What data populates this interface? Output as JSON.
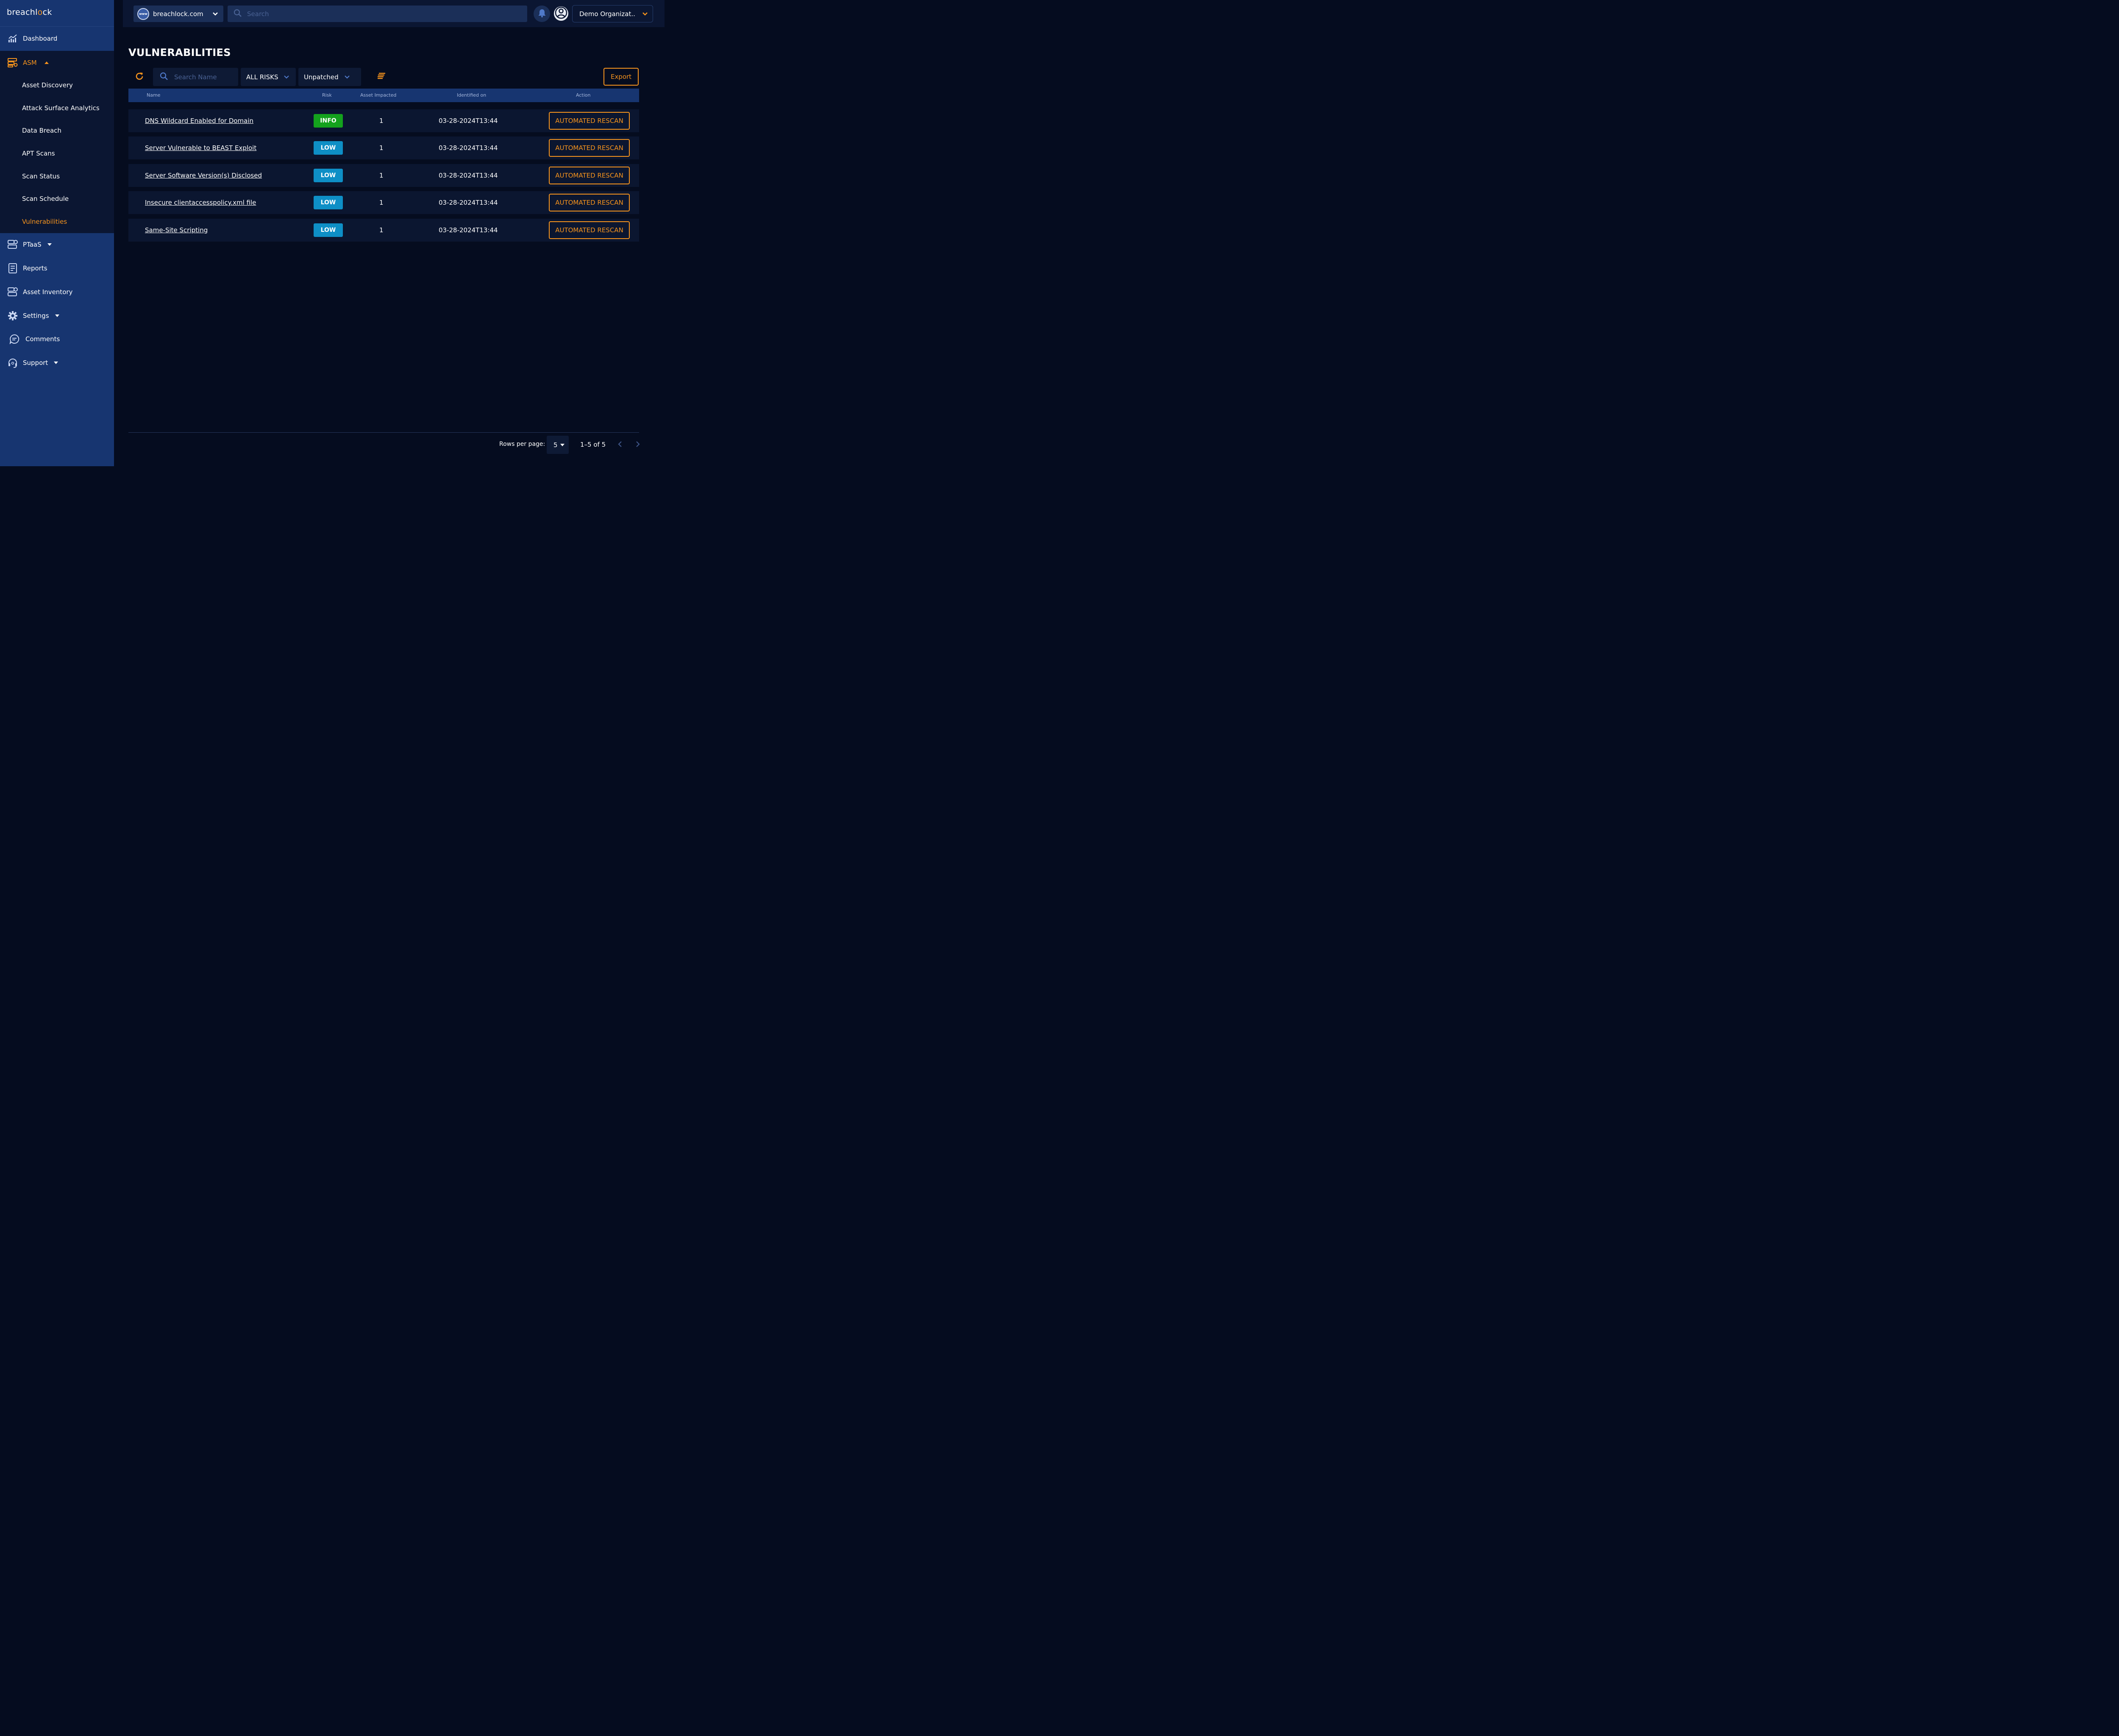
{
  "sidebar": {
    "logo": {
      "text_before": "breachl",
      "mark": "o",
      "text_after": "ck"
    },
    "dashboard": {
      "label": "Dashboard",
      "icon": "chart-line-icon"
    },
    "asm": {
      "label": "ASM",
      "icon": "asm-icon",
      "items": [
        {
          "label": "Asset Discovery"
        },
        {
          "label": "Attack Surface Analytics"
        },
        {
          "label": "Data Breach"
        },
        {
          "label": "APT Scans"
        },
        {
          "label": "Scan Status"
        },
        {
          "label": "Scan Schedule"
        },
        {
          "label": "Vulnerabilities",
          "active": true
        }
      ]
    },
    "ptaas": {
      "label": "PTaaS",
      "icon": "ptaas-icon"
    },
    "reports": {
      "label": "Reports",
      "icon": "report-icon"
    },
    "asset_inventory": {
      "label": "Asset Inventory",
      "icon": "asset-inventory-icon"
    },
    "settings": {
      "label": "Settings",
      "icon": "gear-icon"
    },
    "comments": {
      "label": "Comments",
      "icon": "comment-icon"
    },
    "support": {
      "label": "Support",
      "icon": "headset-icon"
    }
  },
  "topbar": {
    "domain": {
      "badge": "www",
      "value": "breachlock.com"
    },
    "search": {
      "placeholder": "Search"
    },
    "organization": {
      "value": "Demo Organizat.."
    }
  },
  "main": {
    "title": "VULNERABILITIES",
    "toolbar": {
      "search_placeholder": "Search Name",
      "risk_filter": "ALL RISKS",
      "status_filter": "Unpatched",
      "export_label": "Export"
    },
    "table": {
      "headers": {
        "name": "Name",
        "risk": "Risk",
        "asset": "Asset Impacted",
        "identified": "Identified on",
        "action": "Action"
      },
      "rows": [
        {
          "name": "DNS Wildcard Enabled for Domain",
          "risk": "INFO",
          "asset": "1",
          "identified": "03-28-2024T13:44",
          "action": "AUTOMATED RESCAN"
        },
        {
          "name": "Server Vulnerable to BEAST Exploit",
          "risk": "LOW",
          "asset": "1",
          "identified": "03-28-2024T13:44",
          "action": "AUTOMATED RESCAN"
        },
        {
          "name": "Server Software Version(s) Disclosed",
          "risk": "LOW",
          "asset": "1",
          "identified": "03-28-2024T13:44",
          "action": "AUTOMATED RESCAN"
        },
        {
          "name": "Insecure clientaccesspolicy.xml file",
          "risk": "LOW",
          "asset": "1",
          "identified": "03-28-2024T13:44",
          "action": "AUTOMATED RESCAN"
        },
        {
          "name": "Same-Site Scripting",
          "risk": "LOW",
          "asset": "1",
          "identified": "03-28-2024T13:44",
          "action": "AUTOMATED RESCAN"
        }
      ]
    },
    "pagination": {
      "rows_label": "Rows per page:",
      "rows_value": "5",
      "range": "1–5 of 5"
    }
  },
  "colors": {
    "accent": "#f7941d",
    "sidebar_bg": "#173570",
    "page_bg": "#050c1f",
    "risk_info": "#14a21d",
    "risk_low": "#0e8fc6"
  }
}
